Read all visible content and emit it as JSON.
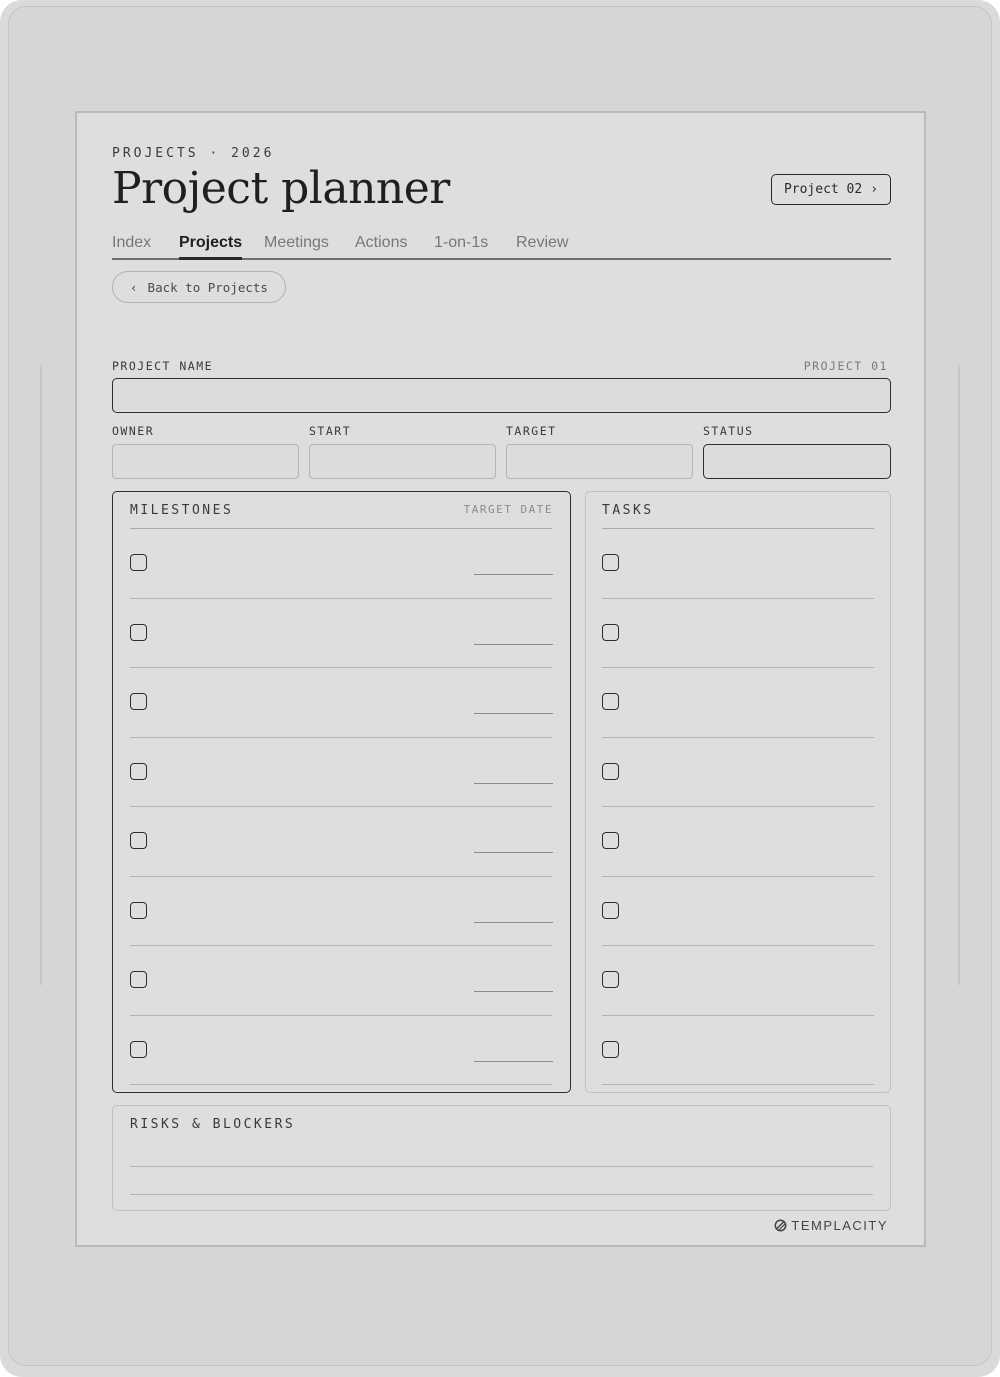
{
  "header": {
    "kicker": "PROJECTS · 2026",
    "title": "Project planner",
    "next_button": {
      "label": "Project 02",
      "icon": "chevron-right-icon",
      "glyph": "›"
    }
  },
  "tabs": [
    {
      "label": "Index",
      "active": false
    },
    {
      "label": "Projects",
      "active": true
    },
    {
      "label": "Meetings",
      "active": false
    },
    {
      "label": "Actions",
      "active": false
    },
    {
      "label": "1-on-1s",
      "active": false
    },
    {
      "label": "Review",
      "active": false
    }
  ],
  "back_button": {
    "label": "Back to Projects",
    "icon": "chevron-left-icon",
    "glyph": "‹"
  },
  "project": {
    "name_label": "PROJECT NAME",
    "number_label": "PROJECT 01",
    "name_value": "",
    "fields": [
      {
        "label": "OWNER",
        "value": ""
      },
      {
        "label": "START",
        "value": ""
      },
      {
        "label": "TARGET",
        "value": ""
      },
      {
        "label": "STATUS",
        "value": ""
      }
    ]
  },
  "milestones": {
    "title": "MILESTONES",
    "subtitle": "TARGET DATE",
    "rows": 8
  },
  "tasks": {
    "title": "TASKS",
    "rows": 8
  },
  "risks": {
    "title": "RISKS & BLOCKERS",
    "lines": 2
  },
  "brand": {
    "name": "TEMPLACITY",
    "icon": "templacity-logo-icon"
  }
}
